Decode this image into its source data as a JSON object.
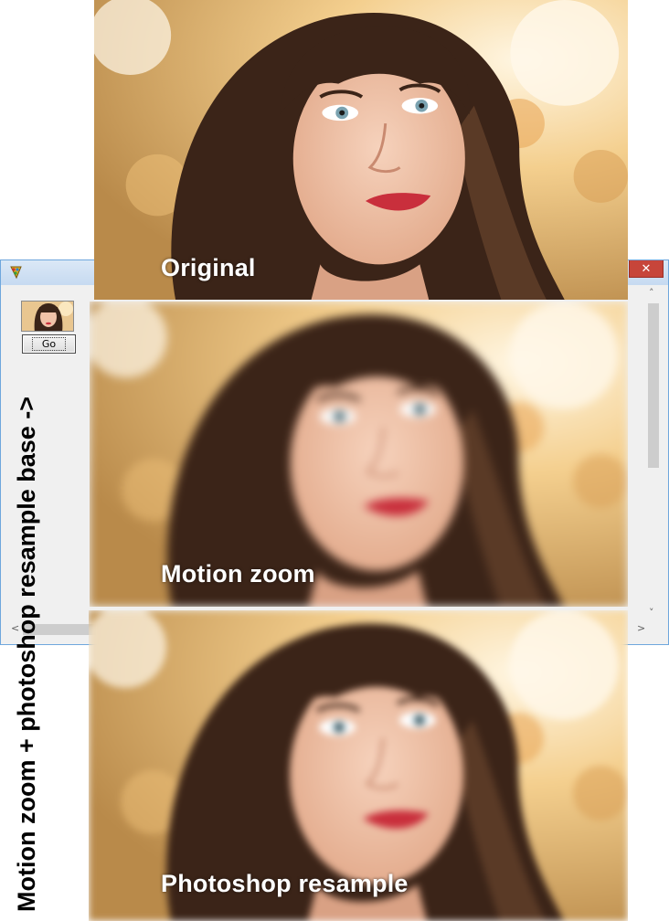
{
  "window": {
    "app_icon": "paint-palette-icon",
    "close_icon": "close-icon",
    "close_glyph": "✕",
    "go_button_label": "Go",
    "scroll_up_glyph": "˄",
    "scroll_down_glyph": "˅",
    "scroll_left_glyph": "<",
    "scroll_right_glyph": ">"
  },
  "panels": [
    {
      "caption": "Original"
    },
    {
      "caption": "Motion zoom"
    },
    {
      "caption": "Photoshop resample"
    }
  ],
  "side_label": "Motion zoom + photoshop resample base ->",
  "colors": {
    "title_bar": "#c6daf1",
    "close_button": "#c7453a",
    "hair": "#3b2418",
    "skin": "#f1c2a8",
    "lips": "#c92f3c",
    "eyes": "#7aa2b0",
    "bokeh": "#f7d9a0"
  }
}
